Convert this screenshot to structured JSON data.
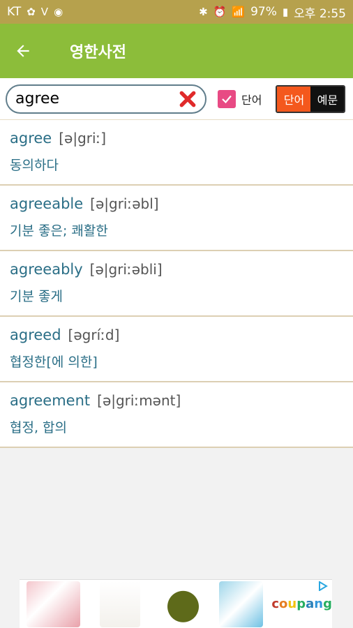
{
  "status": {
    "carrier": "KT",
    "battery": "97%",
    "time": "오후 2:55"
  },
  "appbar": {
    "title": "영한사전"
  },
  "search": {
    "value": "agree",
    "checkbox_label": "단어",
    "toggle_word": "단어",
    "toggle_example": "예문"
  },
  "results": [
    {
      "word": "agree",
      "pron": "[ə|griː]",
      "meaning": "동의하다"
    },
    {
      "word": "agreeable",
      "pron": "[ə|griːəbl]",
      "meaning": "기분 좋은; 쾌활한"
    },
    {
      "word": "agreeably",
      "pron": "[ə|griːəbli]",
      "meaning": "기분 좋게"
    },
    {
      "word": "agreed",
      "pron": "[əgríːd]",
      "meaning": "협정한[에 의한]"
    },
    {
      "word": "agreement",
      "pron": "[ə|griːmənt]",
      "meaning": "협정, 합의"
    }
  ],
  "ad": {
    "brand": "coupang"
  },
  "colors": {
    "appbar": "#8cbd3a",
    "statusbar": "#b6a14d",
    "accent": "#f4581d",
    "checkbox": "#e84a84"
  }
}
